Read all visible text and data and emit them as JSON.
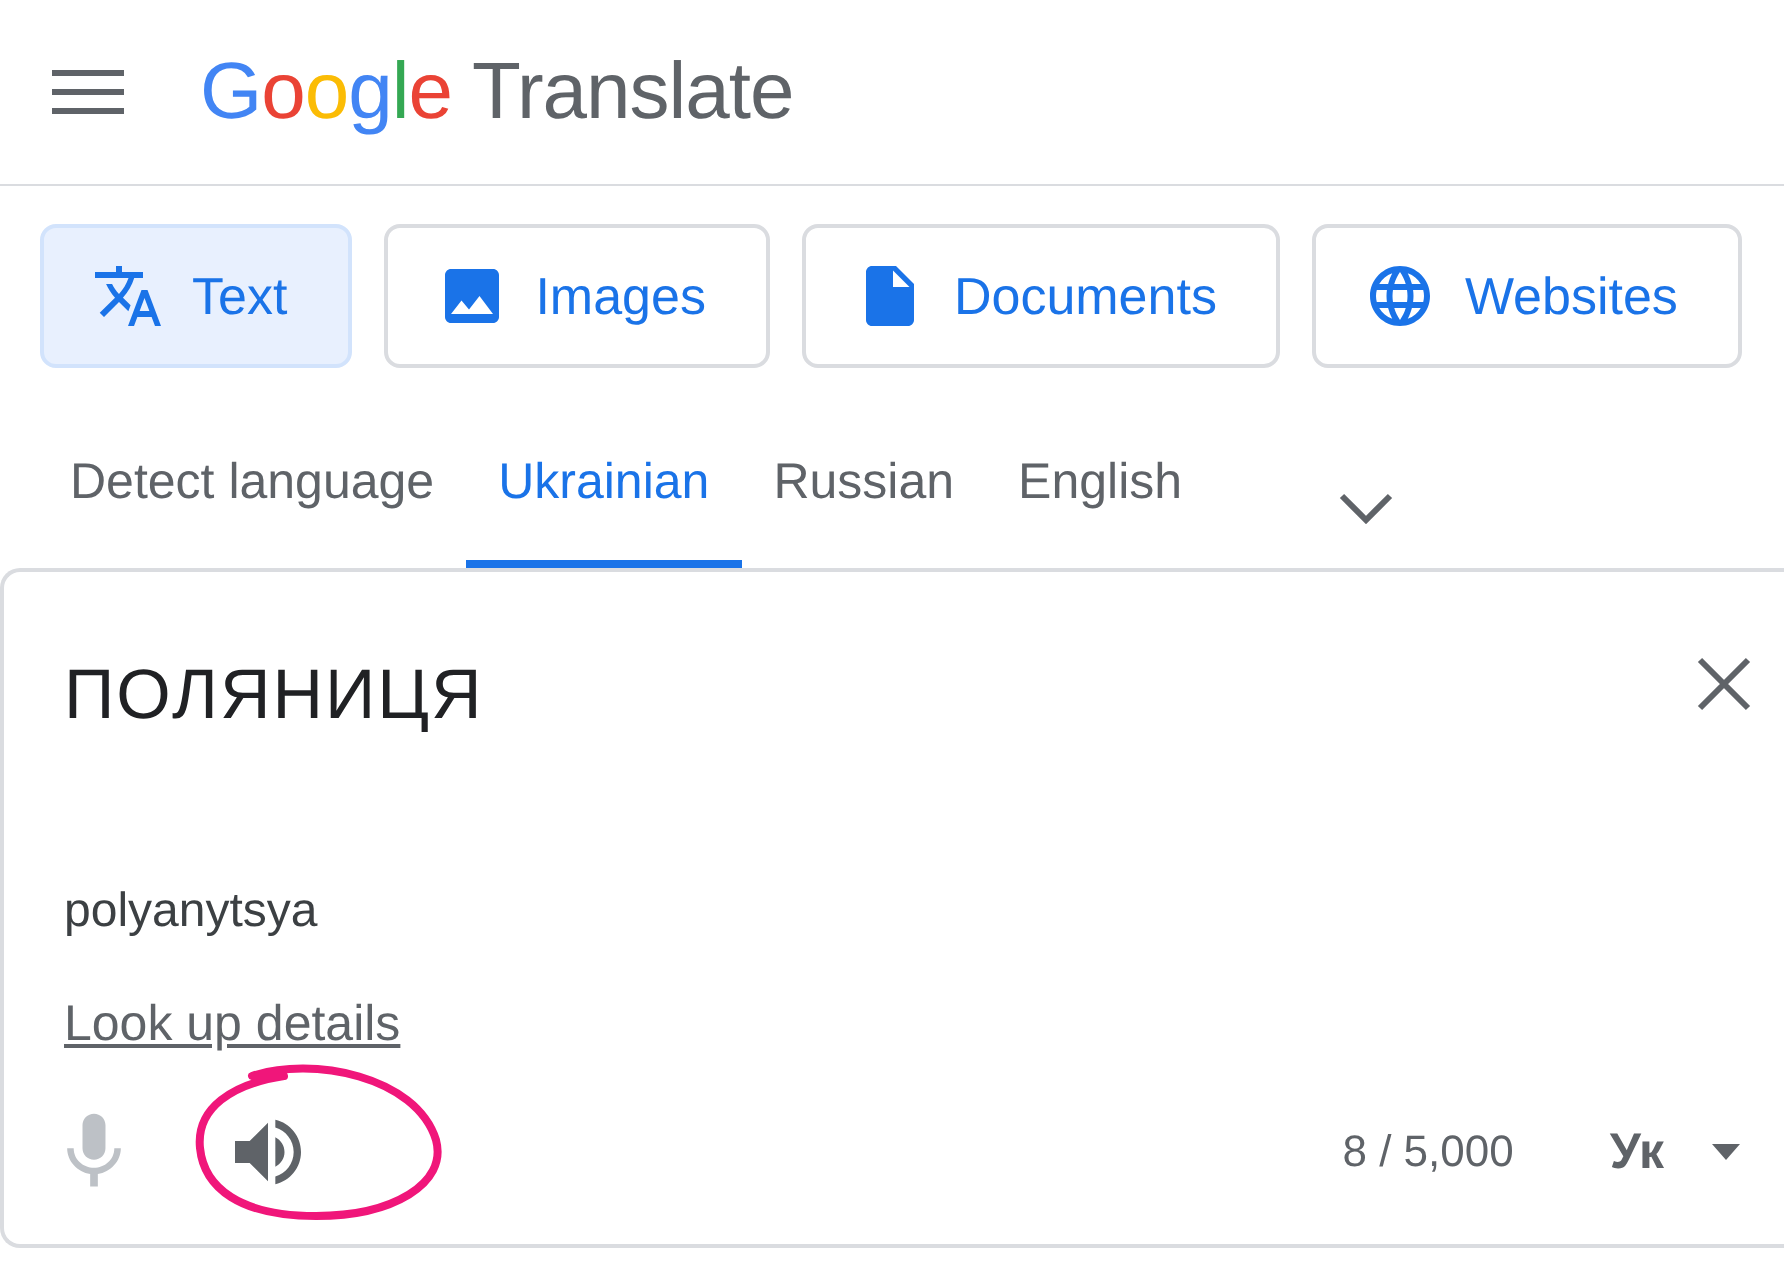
{
  "logo": {
    "brand": "Google",
    "product": "Translate"
  },
  "modes": [
    {
      "kind": "text",
      "label": "Text",
      "selected": true
    },
    {
      "kind": "images",
      "label": "Images",
      "selected": false
    },
    {
      "kind": "documents",
      "label": "Documents",
      "selected": false
    },
    {
      "kind": "websites",
      "label": "Websites",
      "selected": false
    }
  ],
  "languages": [
    {
      "label": "Detect language",
      "selected": false
    },
    {
      "label": "Ukrainian",
      "selected": true
    },
    {
      "label": "Russian",
      "selected": false
    },
    {
      "label": "English",
      "selected": false
    }
  ],
  "source": {
    "text": "ПОЛЯНИЦЯ",
    "transliteration": "polyanytsya",
    "link": "Look up details",
    "mic": {
      "disabled": true
    },
    "char_count": "8 / 5,000",
    "input_tool": "Ук"
  }
}
